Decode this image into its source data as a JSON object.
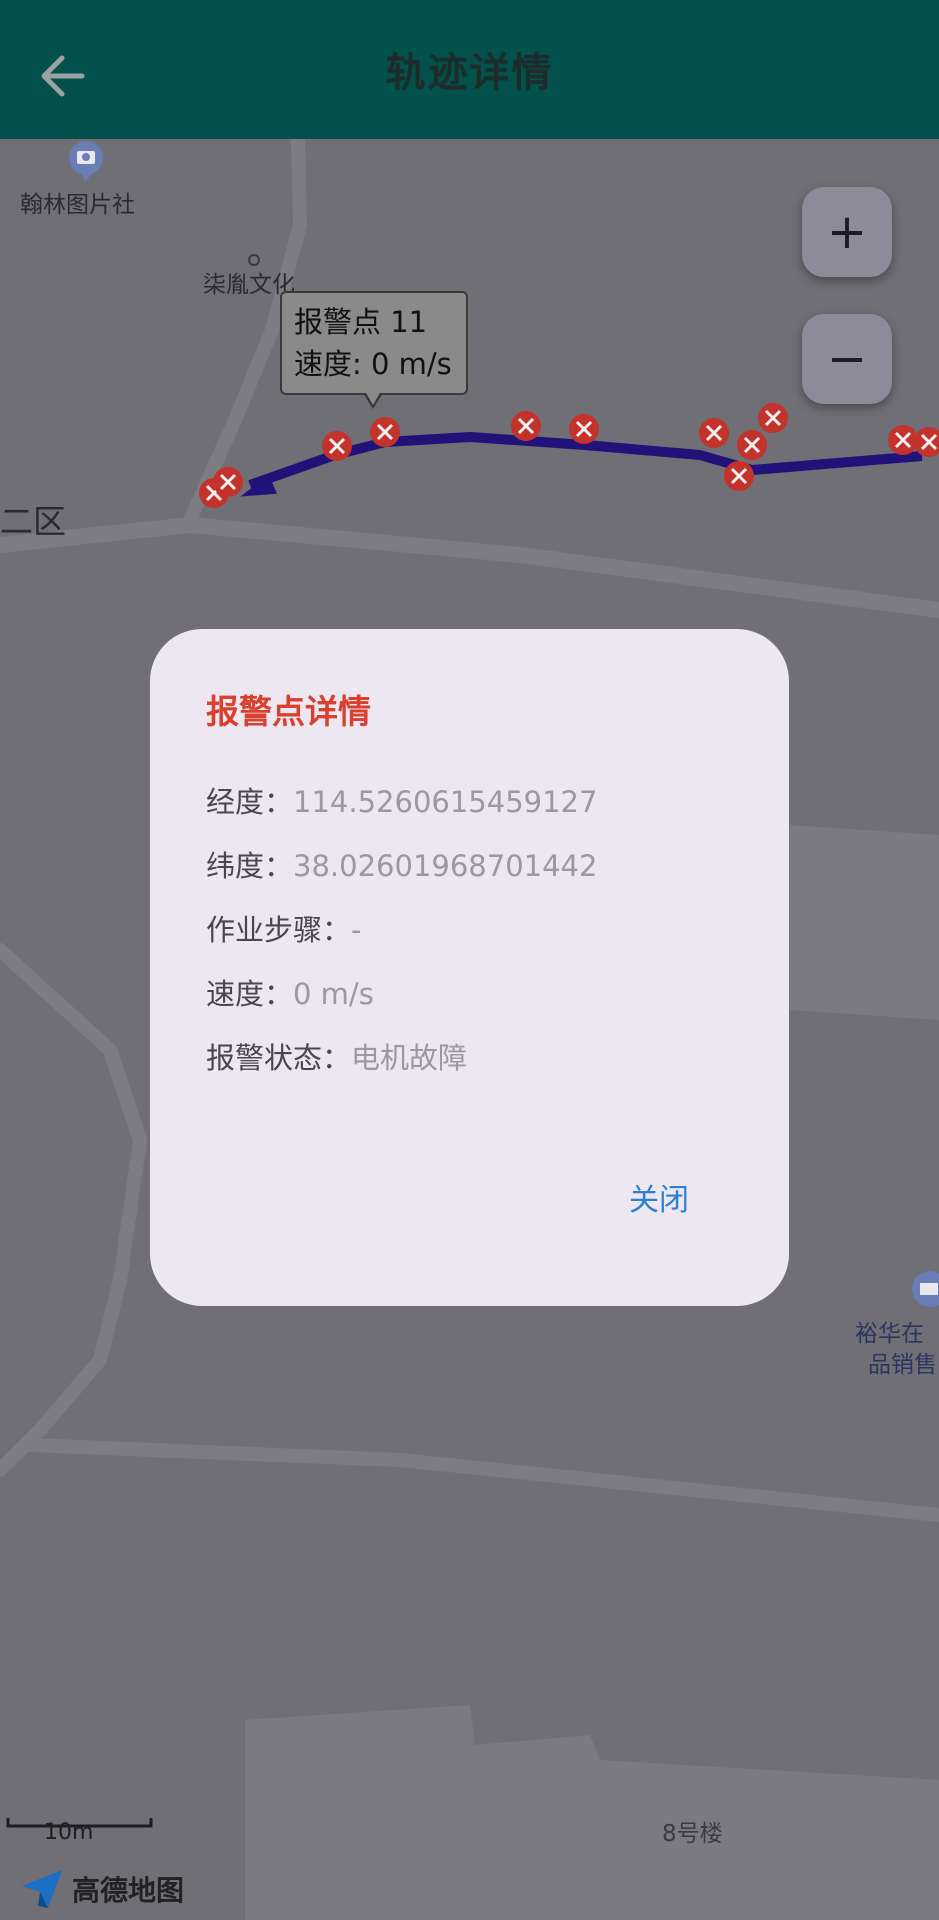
{
  "header": {
    "title": "轨迹详情",
    "bg_color": "#02514c"
  },
  "map": {
    "pois": [
      {
        "name": "翰林图片社"
      },
      {
        "name": "柒胤文化"
      },
      {
        "name": "二区"
      },
      {
        "name": "裕华在"
      },
      {
        "name": "品销售"
      },
      {
        "name": "8号楼"
      }
    ],
    "zoom_in_label": "+",
    "zoom_out_label": "−",
    "tooltip": {
      "title": "报警点 11",
      "speed": "速度: 0 m/s"
    },
    "scale_label": "10m",
    "logo_text": "高德地图",
    "route_color": "#21127a",
    "alarm_marker_color": "#c4322c"
  },
  "dialog": {
    "title": "报警点详情",
    "rows": [
      {
        "label": "经度：",
        "value": "114.5260615459127"
      },
      {
        "label": "纬度：",
        "value": "38.02601968701442"
      },
      {
        "label": "作业步骤：",
        "value": "-"
      },
      {
        "label": "速度：",
        "value": "0 m/s"
      },
      {
        "label": "报警状态：",
        "value": "电机故障"
      }
    ],
    "close_label": "关闭"
  }
}
